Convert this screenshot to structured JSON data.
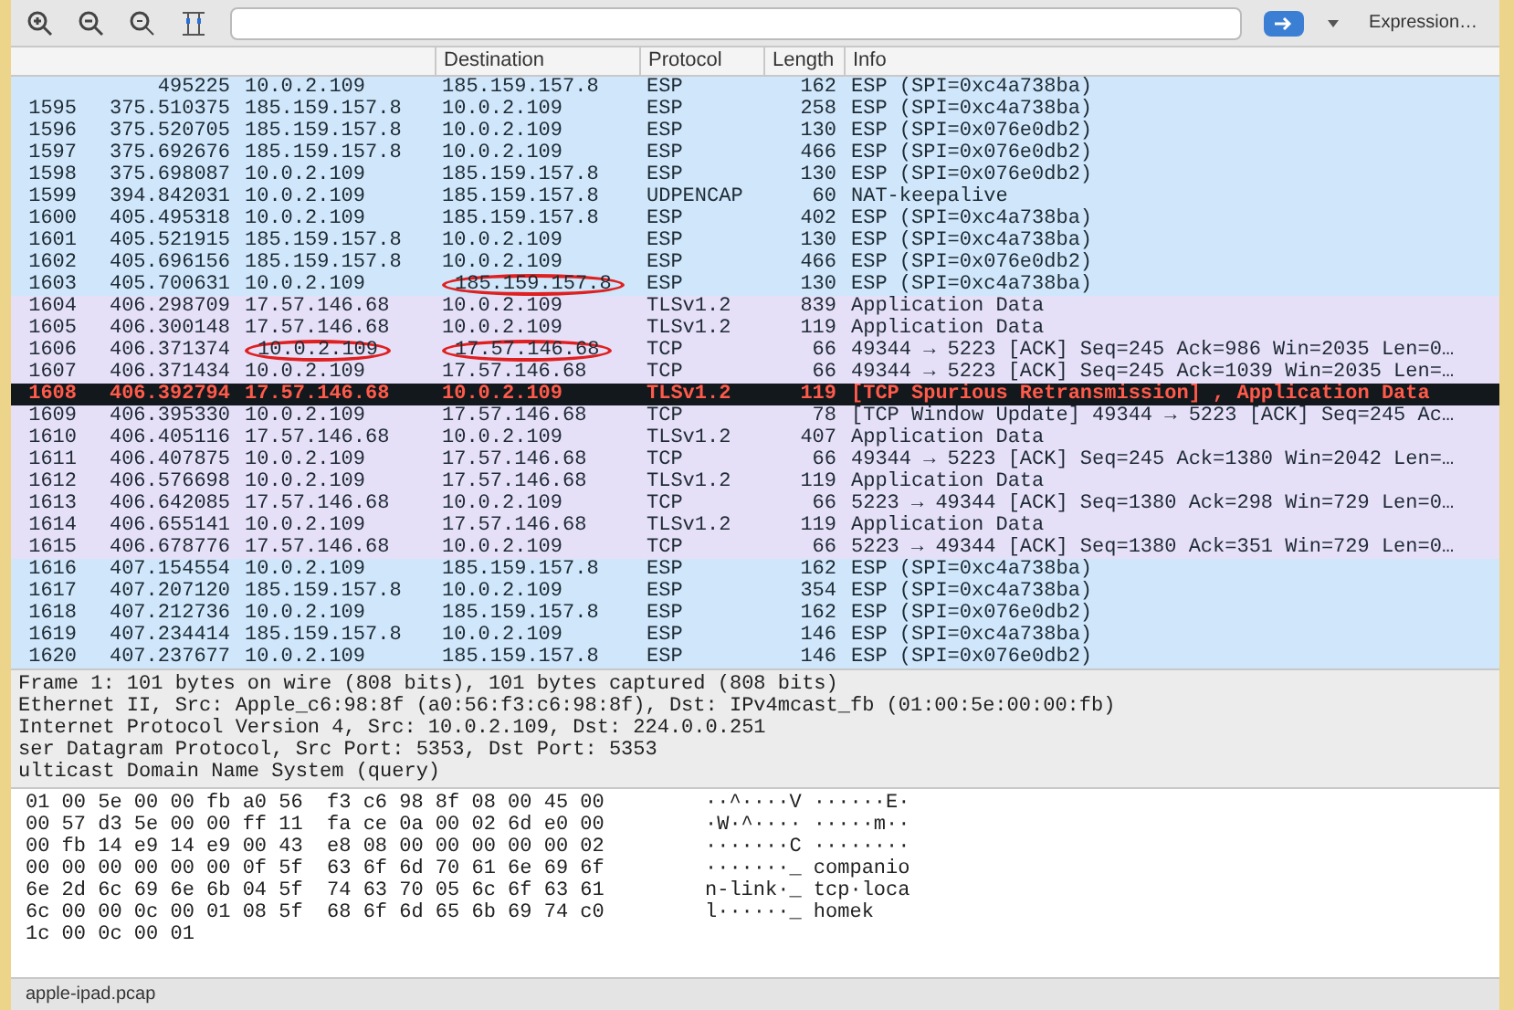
{
  "toolbar": {
    "expression_button": "Expression…"
  },
  "packet_list": {
    "columns": [
      "Destination",
      "Protocol",
      "Length",
      "Info"
    ],
    "rows": [
      {
        "time": "495225",
        "source": "10.0.2.109",
        "destination": "185.159.157.8",
        "protocol": "ESP",
        "length": "162",
        "info": "ESP (SPI=0xc4a738ba)",
        "color": "#cfe6fb",
        "selected": false,
        "source_circled": false,
        "destination_circled": false
      },
      {
        "no": "1595",
        "time": "375.510375",
        "source": "185.159.157.8",
        "destination": "10.0.2.109",
        "protocol": "ESP",
        "length": "258",
        "info": "ESP (SPI=0xc4a738ba)",
        "color": "#cfe6fb",
        "selected": false,
        "source_circled": false,
        "destination_circled": false
      },
      {
        "no": "1596",
        "time": "375.520705",
        "source": "185.159.157.8",
        "destination": "10.0.2.109",
        "protocol": "ESP",
        "length": "130",
        "info": "ESP (SPI=0x076e0db2)",
        "color": "#cfe6fb",
        "selected": false,
        "source_circled": false,
        "destination_circled": false
      },
      {
        "no": "1597",
        "time": "375.692676",
        "source": "185.159.157.8",
        "destination": "10.0.2.109",
        "protocol": "ESP",
        "length": "466",
        "info": "ESP (SPI=0x076e0db2)",
        "color": "#cfe6fb",
        "selected": false,
        "source_circled": false,
        "destination_circled": false
      },
      {
        "no": "1598",
        "time": "375.698087",
        "source": "10.0.2.109",
        "destination": "185.159.157.8",
        "protocol": "ESP",
        "length": "130",
        "info": "ESP (SPI=0x076e0db2)",
        "color": "#cfe6fb",
        "selected": false,
        "source_circled": false,
        "destination_circled": false
      },
      {
        "no": "1599",
        "time": "394.842031",
        "source": "10.0.2.109",
        "destination": "185.159.157.8",
        "protocol": "UDPENCAP",
        "length": "60",
        "info": "NAT-keepalive",
        "color": "#cfe6fb",
        "selected": false,
        "source_circled": false,
        "destination_circled": false
      },
      {
        "no": "1600",
        "time": "405.495318",
        "source": "10.0.2.109",
        "destination": "185.159.157.8",
        "protocol": "ESP",
        "length": "402",
        "info": "ESP (SPI=0xc4a738ba)",
        "color": "#cfe6fb",
        "selected": false,
        "source_circled": false,
        "destination_circled": false
      },
      {
        "no": "1601",
        "time": "405.521915",
        "source": "185.159.157.8",
        "destination": "10.0.2.109",
        "protocol": "ESP",
        "length": "130",
        "info": "ESP (SPI=0xc4a738ba)",
        "color": "#cfe6fb",
        "selected": false,
        "source_circled": false,
        "destination_circled": false
      },
      {
        "no": "1602",
        "time": "405.696156",
        "source": "185.159.157.8",
        "destination": "10.0.2.109",
        "protocol": "ESP",
        "length": "466",
        "info": "ESP (SPI=0x076e0db2)",
        "color": "#cfe6fb",
        "selected": false,
        "source_circled": false,
        "destination_circled": false
      },
      {
        "no": "1603",
        "time": "405.700631",
        "source": "10.0.2.109",
        "destination": "185.159.157.8",
        "protocol": "ESP",
        "length": "130",
        "info": "ESP (SPI=0xc4a738ba)",
        "color": "#cfe6fb",
        "selected": false,
        "source_circled": false,
        "destination_circled": true
      },
      {
        "no": "1604",
        "time": "406.298709",
        "source": "17.57.146.68",
        "destination": "10.0.2.109",
        "protocol": "TLSv1.2",
        "length": "839",
        "info": "Application Data",
        "color": "#e6dff8",
        "selected": false,
        "source_circled": false,
        "destination_circled": false
      },
      {
        "no": "1605",
        "time": "406.300148",
        "source": "17.57.146.68",
        "destination": "10.0.2.109",
        "protocol": "TLSv1.2",
        "length": "119",
        "info": "Application Data",
        "color": "#e6dff8",
        "selected": false,
        "source_circled": false,
        "destination_circled": false
      },
      {
        "no": "1606",
        "time": "406.371374",
        "source": "10.0.2.109",
        "destination": "17.57.146.68",
        "protocol": "TCP",
        "length": "66",
        "info": "49344 → 5223 [ACK] Seq=245 Ack=986 Win=2035 Len=0…",
        "color": "#e6dff8",
        "selected": false,
        "source_circled": true,
        "destination_circled": true
      },
      {
        "no": "1607",
        "time": "406.371434",
        "source": "10.0.2.109",
        "destination": "17.57.146.68",
        "protocol": "TCP",
        "length": "66",
        "info": "49344 → 5223 [ACK] Seq=245 Ack=1039 Win=2035 Len=…",
        "color": "#e6dff8",
        "selected": false,
        "source_circled": false,
        "destination_circled": false
      },
      {
        "no": "1608",
        "time": "406.392794",
        "source": "17.57.146.68",
        "destination": "10.0.2.109",
        "protocol": "TLSv1.2",
        "length": "119",
        "info": "[TCP Spurious Retransmission] , Application Data",
        "color": "#12181c",
        "selected": true,
        "source_circled": false,
        "destination_circled": false
      },
      {
        "no": "1609",
        "time": "406.395330",
        "source": "10.0.2.109",
        "destination": "17.57.146.68",
        "protocol": "TCP",
        "length": "78",
        "info": "[TCP Window Update] 49344 → 5223 [ACK] Seq=245 Ac…",
        "color": "#e6dff8",
        "selected": false,
        "source_circled": false,
        "destination_circled": false
      },
      {
        "no": "1610",
        "time": "406.405116",
        "source": "17.57.146.68",
        "destination": "10.0.2.109",
        "protocol": "TLSv1.2",
        "length": "407",
        "info": "Application Data",
        "color": "#e6dff8",
        "selected": false,
        "source_circled": false,
        "destination_circled": false
      },
      {
        "no": "1611",
        "time": "406.407875",
        "source": "10.0.2.109",
        "destination": "17.57.146.68",
        "protocol": "TCP",
        "length": "66",
        "info": "49344 → 5223 [ACK] Seq=245 Ack=1380 Win=2042 Len=…",
        "color": "#e6dff8",
        "selected": false,
        "source_circled": false,
        "destination_circled": false
      },
      {
        "no": "1612",
        "time": "406.576698",
        "source": "10.0.2.109",
        "destination": "17.57.146.68",
        "protocol": "TLSv1.2",
        "length": "119",
        "info": "Application Data",
        "color": "#e6dff8",
        "selected": false,
        "source_circled": false,
        "destination_circled": false
      },
      {
        "no": "1613",
        "time": "406.642085",
        "source": "17.57.146.68",
        "destination": "10.0.2.109",
        "protocol": "TCP",
        "length": "66",
        "info": "5223 → 49344 [ACK] Seq=1380 Ack=298 Win=729 Len=0…",
        "color": "#e6dff8",
        "selected": false,
        "source_circled": false,
        "destination_circled": false
      },
      {
        "no": "1614",
        "time": "406.655141",
        "source": "10.0.2.109",
        "destination": "17.57.146.68",
        "protocol": "TLSv1.2",
        "length": "119",
        "info": "Application Data",
        "color": "#e6dff8",
        "selected": false,
        "source_circled": false,
        "destination_circled": false
      },
      {
        "no": "1615",
        "time": "406.678776",
        "source": "17.57.146.68",
        "destination": "10.0.2.109",
        "protocol": "TCP",
        "length": "66",
        "info": "5223 → 49344 [ACK] Seq=1380 Ack=351 Win=729 Len=0…",
        "color": "#e6dff8",
        "selected": false,
        "source_circled": false,
        "destination_circled": false
      },
      {
        "no": "1616",
        "time": "407.154554",
        "source": "10.0.2.109",
        "destination": "185.159.157.8",
        "protocol": "ESP",
        "length": "162",
        "info": "ESP (SPI=0xc4a738ba)",
        "color": "#cfe6fb",
        "selected": false,
        "source_circled": false,
        "destination_circled": false
      },
      {
        "no": "1617",
        "time": "407.207120",
        "source": "185.159.157.8",
        "destination": "10.0.2.109",
        "protocol": "ESP",
        "length": "354",
        "info": "ESP (SPI=0xc4a738ba)",
        "color": "#cfe6fb",
        "selected": false,
        "source_circled": false,
        "destination_circled": false
      },
      {
        "no": "1618",
        "time": "407.212736",
        "source": "10.0.2.109",
        "destination": "185.159.157.8",
        "protocol": "ESP",
        "length": "162",
        "info": "ESP (SPI=0x076e0db2)",
        "color": "#cfe6fb",
        "selected": false,
        "source_circled": false,
        "destination_circled": false
      },
      {
        "no": "1619",
        "time": "407.234414",
        "source": "185.159.157.8",
        "destination": "10.0.2.109",
        "protocol": "ESP",
        "length": "146",
        "info": "ESP (SPI=0xc4a738ba)",
        "color": "#cfe6fb",
        "selected": false,
        "source_circled": false,
        "destination_circled": false
      },
      {
        "no": "1620",
        "time": "407.237677",
        "source": "10.0.2.109",
        "destination": "185.159.157.8",
        "protocol": "ESP",
        "length": "146",
        "info": "ESP (SPI=0x076e0db2)",
        "color": "#cfe6fb",
        "selected": false,
        "source_circled": false,
        "destination_circled": false
      }
    ]
  },
  "details": [
    "Frame 1: 101 bytes on wire (808 bits), 101 bytes captured (808 bits)",
    "Ethernet II, Src: Apple_c6:98:8f (a0:56:f3:c6:98:8f), Dst: IPv4mcast_fb (01:00:5e:00:00:fb)",
    "Internet Protocol Version 4, Src: 10.0.2.109, Dst: 224.0.0.251",
    "ser Datagram Protocol, Src Port: 5353, Dst Port: 5353",
    "ulticast Domain Name System (query)"
  ],
  "hex_dump": [
    {
      "bytes": "01 00 5e 00 00 fb a0 56  f3 c6 98 8f 08 00 45 00",
      "ascii": "··^····V ······E·"
    },
    {
      "bytes": "00 57 d3 5e 00 00 ff 11  fa ce 0a 00 02 6d e0 00",
      "ascii": "·W·^···· ·····m··"
    },
    {
      "bytes": "00 fb 14 e9 14 e9 00 43  e8 08 00 00 00 00 00 02",
      "ascii": "·······C ········"
    },
    {
      "bytes": "00 00 00 00 00 00 0f 5f  63 6f 6d 70 61 6e 69 6f",
      "ascii": "·······_ companio"
    },
    {
      "bytes": "6e 2d 6c 69 6e 6b 04 5f  74 63 70 05 6c 6f 63 61",
      "ascii": "n-link·_ tcp·loca"
    },
    {
      "bytes": "6c 00 00 0c 00 01 08 5f  68 6f 6d 65 6b 69 74 c0",
      "ascii": "l······_ homek"
    },
    {
      "bytes": "1c 00 0c 00 01"
    }
  ],
  "status_bar": {
    "file": "apple-ipad.pcap"
  }
}
